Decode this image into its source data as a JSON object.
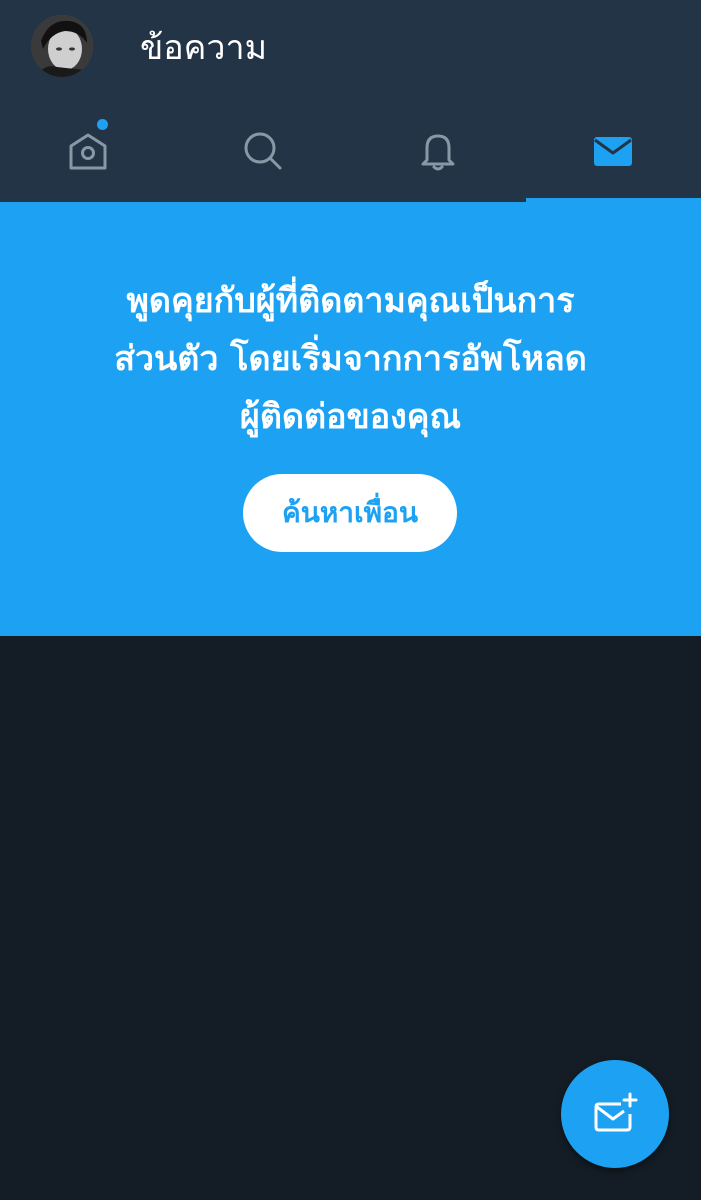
{
  "header": {
    "title": "ข้อความ",
    "avatar_icon": "profile-photo-icon"
  },
  "tabs": [
    {
      "name": "home",
      "icon": "home-icon",
      "has_notification_dot": true,
      "active": false
    },
    {
      "name": "search",
      "icon": "search-icon",
      "has_notification_dot": false,
      "active": false
    },
    {
      "name": "notifications",
      "icon": "bell-icon",
      "has_notification_dot": false,
      "active": false
    },
    {
      "name": "messages",
      "icon": "envelope-icon",
      "has_notification_dot": false,
      "active": true
    }
  ],
  "banner": {
    "line1": "พูดคุยกับผู้ที่ติดตามคุณเป็นการ",
    "line2": "ส่วนตัว โดยเริ่มจากการอัพโหลด",
    "line3": "ผู้ติดต่อของคุณ",
    "button_label": "ค้นหาเพื่อน"
  },
  "fab": {
    "icon": "new-message-icon"
  },
  "colors": {
    "accent": "#1da1f2",
    "header_bg": "#243447",
    "page_bg": "#141d26",
    "inactive_icon": "#8899a6"
  }
}
